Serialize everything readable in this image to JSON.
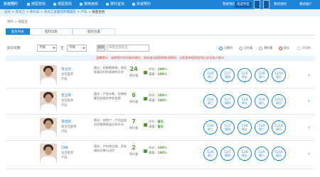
{
  "topnav": {
    "logo": "快速预约",
    "items": [
      "按医院找",
      "按医院找",
      "按疾病找",
      "按科室找",
      "快速预约"
    ],
    "right_buttons": [
      "我要预约",
      "电话专区",
      "下载APP",
      "我的预约",
      "我的账户"
    ]
  },
  "breadcrumb": {
    "items": [
      "首页",
      "黑龙江",
      "哈尔滨",
      "黑龙江省医院附属医院",
      "产科",
      "按医生找"
    ],
    "separator": " › "
  },
  "subtitle": "预约 > 按医生",
  "tabs": [
    "医生列表",
    "医院信息",
    "医院位置"
  ],
  "filter": {
    "label": "就诊日期:",
    "select1": "不限",
    "to": "至",
    "select2": "不限",
    "search_button": "搜索",
    "search_placeholder": "按姓名搜医生",
    "legends": [
      "可预约",
      "已约满",
      "预约满",
      "停诊",
      "不可约"
    ]
  },
  "notice": "温馨提示：请按预约时间准时就诊，如有变动请提前取消预约，以免影响您的信用记录及他人就诊",
  "doctors": [
    {
      "name": "曾立华",
      "title": "主任医师",
      "dept": "产科",
      "specialty": "擅长：妊娠期疾病、高危妊娠及妇科疾病的诊治",
      "count": "24",
      "count_label": "预约量",
      "eval_label": "评价：",
      "eval_value": "100%",
      "eval_label2": "满意：",
      "eval_value2": "100%",
      "slots": [
        [
          "11/6",
          "周三"
        ],
        [
          "11/7",
          "周四"
        ],
        [
          "11/8",
          "周五"
        ],
        [
          "11/9",
          "周六"
        ],
        [
          "11/10",
          "周日"
        ]
      ]
    },
    {
      "name": "曾玉琴",
      "title": "主任医师",
      "dept": "产科",
      "specialty": "擅长：产前诊断、孕期保健及妊娠合并症处理",
      "count": "6",
      "count_label": "预约量",
      "eval_label": "评价：",
      "eval_value": "100%",
      "eval_label2": "满意：",
      "eval_value2": "100%",
      "slots": [
        [
          "11/6",
          "周三"
        ],
        [
          "11/7",
          "周四"
        ],
        [
          "11/8",
          "周五"
        ],
        [
          "11/9",
          "周六"
        ],
        [
          "11/10",
          "周日"
        ]
      ]
    },
    {
      "name": "李绍初",
      "title": "副主任医师",
      "dept": "产科",
      "specialty": "擅长：剖宫产、产后出血及妊娠期高血压的诊治",
      "count": "7",
      "count_label": "预约量",
      "eval_label": "评价：",
      "eval_value": "暂无",
      "eval_label2": "满意：",
      "eval_value2": "暂无",
      "slots": [
        [
          "11/6",
          "周三"
        ],
        [
          "11/7",
          "周四"
        ],
        [
          "11/8",
          "周五"
        ],
        [
          "11/9",
          "周六"
        ],
        [
          "11/10",
          "周日"
        ]
      ]
    },
    {
      "name": "刘琳",
      "title": "主治医师",
      "dept": "产科",
      "specialty": "擅长：产科常见病、多发病的诊断与治疗",
      "count": "2",
      "count_label": "预约量",
      "eval_label": "评价：",
      "eval_value": "100%",
      "eval_label2": "满意：",
      "eval_value2": "100%",
      "slots": [
        [
          "11/6",
          "周三"
        ],
        [
          "11/7",
          "周四"
        ],
        [
          "11/8",
          "周五"
        ],
        [
          "11/9",
          "周六"
        ],
        [
          "11/10",
          "周日"
        ]
      ]
    }
  ],
  "colors": {
    "primary": "#1e84d6",
    "green": "#4e9a2e",
    "red": "#e2452b"
  }
}
